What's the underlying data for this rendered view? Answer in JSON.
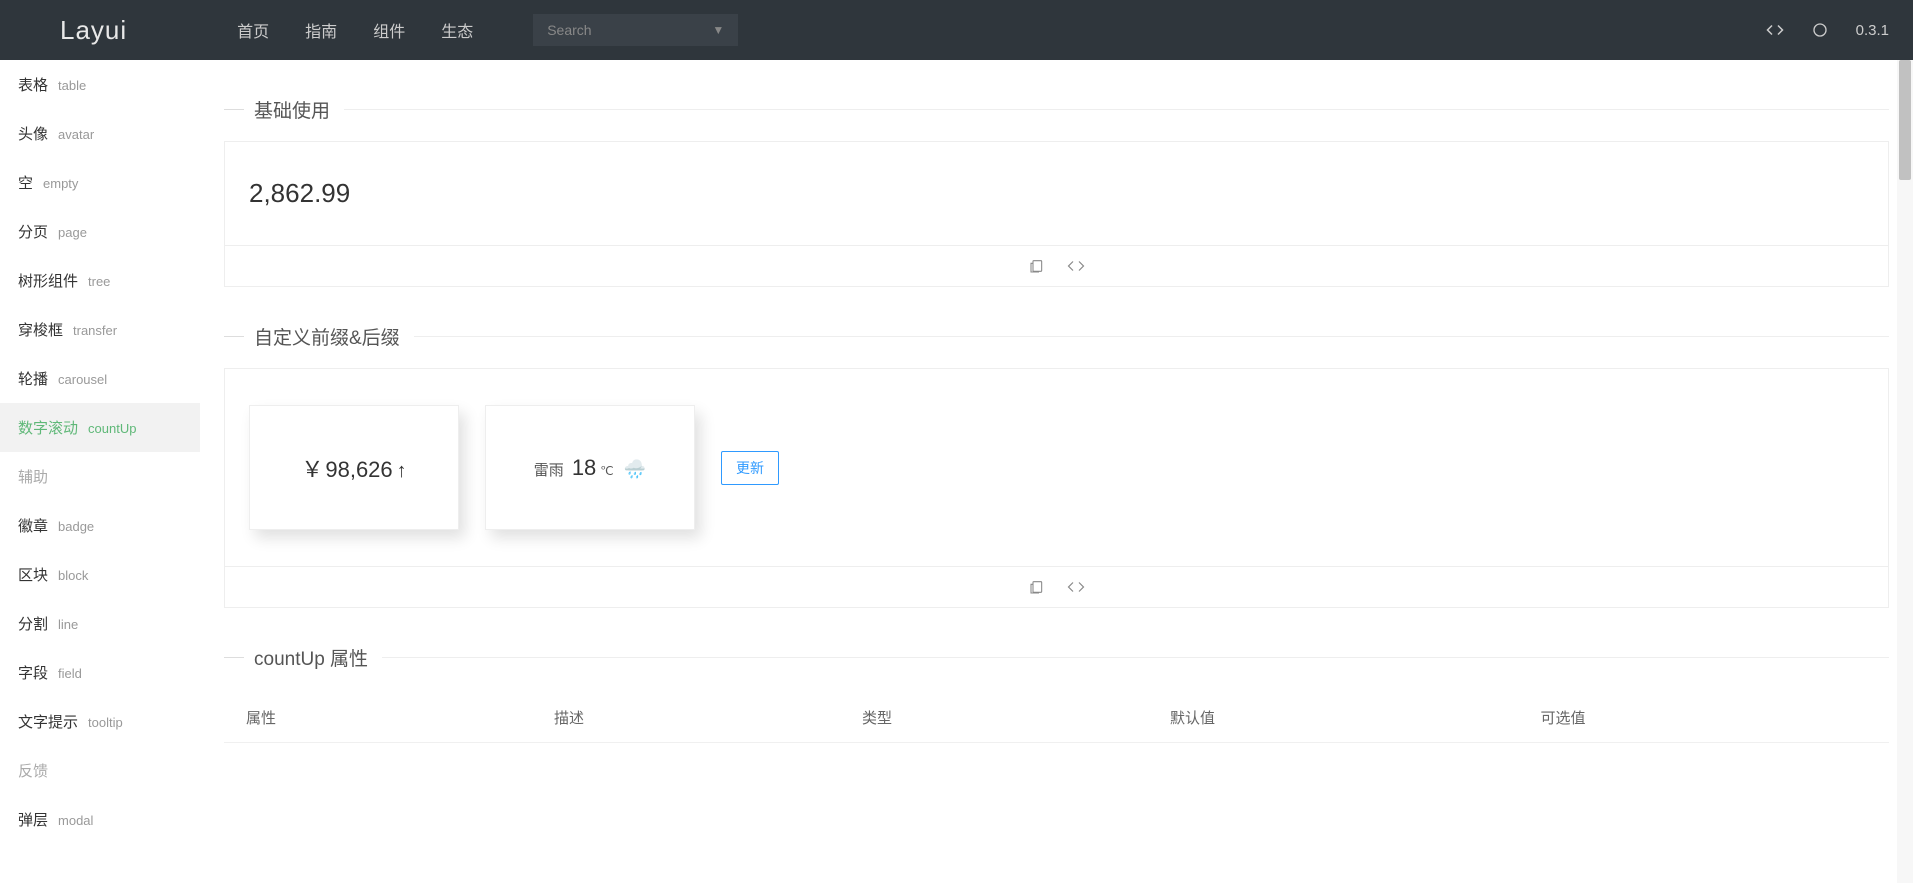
{
  "header": {
    "logo": "Layui",
    "nav": [
      "首页",
      "指南",
      "组件",
      "生态"
    ],
    "search_placeholder": "Search",
    "version": "0.3.1"
  },
  "sidebar": {
    "items": [
      {
        "cn": "表格",
        "en": "table"
      },
      {
        "cn": "头像",
        "en": "avatar"
      },
      {
        "cn": "空",
        "en": "empty"
      },
      {
        "cn": "分页",
        "en": "page"
      },
      {
        "cn": "树形组件",
        "en": "tree"
      },
      {
        "cn": "穿梭框",
        "en": "transfer"
      },
      {
        "cn": "轮播",
        "en": "carousel"
      },
      {
        "cn": "数字滚动",
        "en": "countUp",
        "active": true
      },
      {
        "group": "辅助"
      },
      {
        "cn": "徽章",
        "en": "badge"
      },
      {
        "cn": "区块",
        "en": "block"
      },
      {
        "cn": "分割",
        "en": "line"
      },
      {
        "cn": "字段",
        "en": "field"
      },
      {
        "cn": "文字提示",
        "en": "tooltip"
      },
      {
        "group": "反馈"
      },
      {
        "cn": "弹层",
        "en": "modal"
      }
    ]
  },
  "sections": {
    "basic": {
      "title": "基础使用",
      "value": "2,862.99"
    },
    "prefix_suffix": {
      "title": "自定义前缀&后缀",
      "card1": {
        "prefix": "￥",
        "value": "98,626",
        "suffix": "↑"
      },
      "card2": {
        "prefix": "雷雨",
        "value": "18",
        "unit": "℃",
        "icon": "🌧️"
      },
      "update_btn": "更新"
    },
    "props": {
      "title": "countUp 属性",
      "columns": [
        "属性",
        "描述",
        "类型",
        "默认值",
        "可选值"
      ]
    }
  }
}
